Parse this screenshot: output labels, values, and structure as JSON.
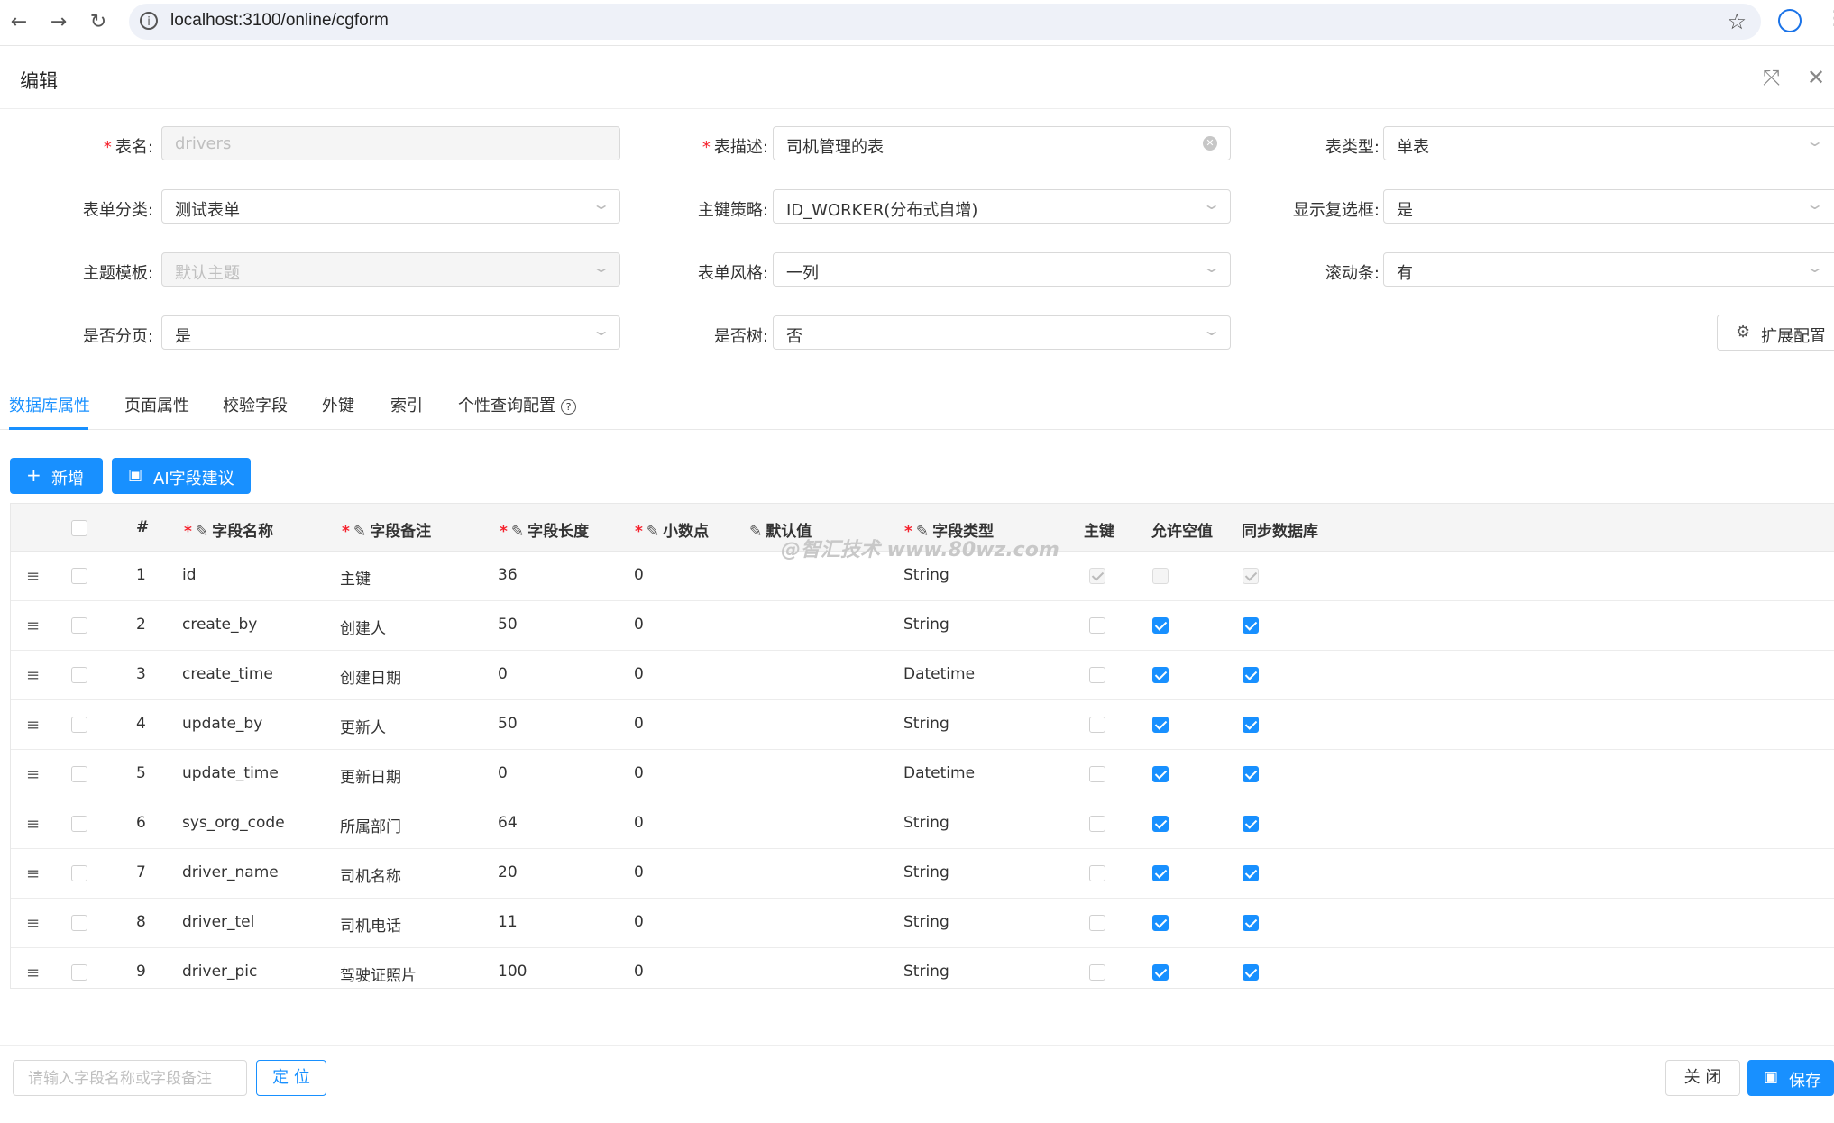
{
  "browser": {
    "url": "localhost:3100/online/cgform",
    "back_icon": "←",
    "forward_icon": "→",
    "reload_icon": "↻",
    "info_icon": "i",
    "star_icon": "☆",
    "kebab_icon": "⋮"
  },
  "modal": {
    "title": "编辑",
    "fullscreen_icon": "⤧",
    "close_icon": "✕"
  },
  "form": {
    "required_mark": "*",
    "table_name": {
      "label": "表名:",
      "value": "drivers"
    },
    "table_desc": {
      "label": "表描述:",
      "value": "司机管理的表"
    },
    "table_type": {
      "label": "表类型:",
      "value": "单表"
    },
    "form_category": {
      "label": "表单分类:",
      "value": "测试表单"
    },
    "pk_strategy": {
      "label": "主键策略:",
      "value": "ID_WORKER(分布式自增)"
    },
    "show_checkbox": {
      "label": "显示复选框:",
      "value": "是"
    },
    "theme_template": {
      "label": "主题模板:",
      "value": "默认主题"
    },
    "form_style": {
      "label": "表单风格:",
      "value": "一列"
    },
    "scrollbar": {
      "label": "滚动条:",
      "value": "有"
    },
    "paging": {
      "label": "是否分页:",
      "value": "是"
    },
    "is_tree": {
      "label": "是否树:",
      "value": "否"
    },
    "chevron": "⌄",
    "clear_icon": "✕",
    "ext_config": {
      "label": "扩展配置",
      "icon": "⚙"
    }
  },
  "tabs": [
    {
      "label": "数据库属性"
    },
    {
      "label": "页面属性"
    },
    {
      "label": "校验字段"
    },
    {
      "label": "外键"
    },
    {
      "label": "索引"
    },
    {
      "label": "个性查询配置"
    }
  ],
  "tab_help_icon": "?",
  "toolbar": {
    "add": {
      "label": "新增",
      "icon": "+"
    },
    "ai": {
      "label": "AI字段建议",
      "icon": "▣"
    }
  },
  "watermark": "@智汇技术 www.80wz.com",
  "table": {
    "edit_icon": "✎",
    "drag_icon": "≡",
    "headers": {
      "index": "#",
      "field_name": "字段名称",
      "field_remark": "字段备注",
      "field_length": "字段长度",
      "decimal": "小数点",
      "default_value": "默认值",
      "field_type": "字段类型",
      "primary_key": "主键",
      "nullable": "允许空值",
      "sync_db": "同步数据库"
    },
    "rows": [
      {
        "index": "1",
        "name": "id",
        "remark": "主键",
        "length": "36",
        "decimal": "0",
        "type": "String",
        "pk": true,
        "nullable": false,
        "sync": true,
        "disabled": true
      },
      {
        "index": "2",
        "name": "create_by",
        "remark": "创建人",
        "length": "50",
        "decimal": "0",
        "type": "String",
        "pk": false,
        "nullable": true,
        "sync": true,
        "disabled": false
      },
      {
        "index": "3",
        "name": "create_time",
        "remark": "创建日期",
        "length": "0",
        "decimal": "0",
        "type": "Datetime",
        "pk": false,
        "nullable": true,
        "sync": true,
        "disabled": false
      },
      {
        "index": "4",
        "name": "update_by",
        "remark": "更新人",
        "length": "50",
        "decimal": "0",
        "type": "String",
        "pk": false,
        "nullable": true,
        "sync": true,
        "disabled": false
      },
      {
        "index": "5",
        "name": "update_time",
        "remark": "更新日期",
        "length": "0",
        "decimal": "0",
        "type": "Datetime",
        "pk": false,
        "nullable": true,
        "sync": true,
        "disabled": false
      },
      {
        "index": "6",
        "name": "sys_org_code",
        "remark": "所属部门",
        "length": "64",
        "decimal": "0",
        "type": "String",
        "pk": false,
        "nullable": true,
        "sync": true,
        "disabled": false
      },
      {
        "index": "7",
        "name": "driver_name",
        "remark": "司机名称",
        "length": "20",
        "decimal": "0",
        "type": "String",
        "pk": false,
        "nullable": true,
        "sync": true,
        "disabled": false
      },
      {
        "index": "8",
        "name": "driver_tel",
        "remark": "司机电话",
        "length": "11",
        "decimal": "0",
        "type": "String",
        "pk": false,
        "nullable": true,
        "sync": true,
        "disabled": false
      },
      {
        "index": "9",
        "name": "driver_pic",
        "remark": "驾驶证照片",
        "length": "100",
        "decimal": "0",
        "type": "String",
        "pk": false,
        "nullable": true,
        "sync": true,
        "disabled": false
      }
    ]
  },
  "footer": {
    "search_placeholder": "请输入字段名称或字段备注",
    "locate_label": "定 位",
    "close_label": "关 闭",
    "save_label": "保存",
    "save_icon": "▣"
  }
}
